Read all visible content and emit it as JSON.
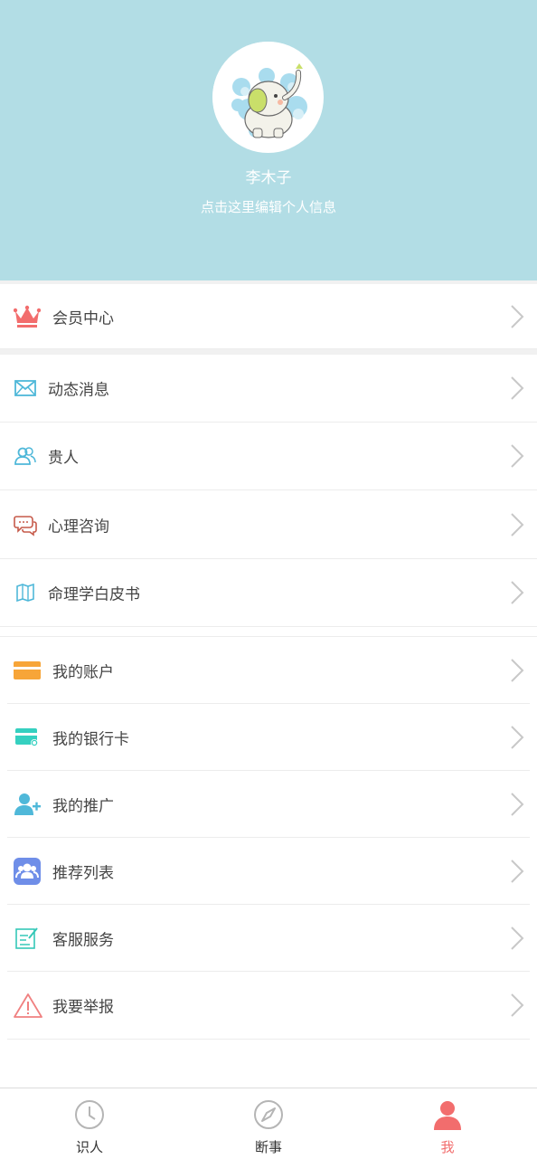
{
  "profile": {
    "name": "李木子",
    "edit_hint": "点击这里编辑个人信息"
  },
  "menu": [
    {
      "label": "会员中心",
      "icon": "crown-icon"
    },
    {
      "label": "动态消息",
      "icon": "envelope-icon"
    },
    {
      "label": "贵人",
      "icon": "people-icon"
    },
    {
      "label": "心理咨询",
      "icon": "chat-bubbles-icon"
    },
    {
      "label": "命理学白皮书",
      "icon": "map-book-icon"
    },
    {
      "label": "我的账户",
      "icon": "card-icon"
    },
    {
      "label": "我的银行卡",
      "icon": "bank-card-icon"
    },
    {
      "label": "我的推广",
      "icon": "add-user-icon"
    },
    {
      "label": "推荐列表",
      "icon": "group-icon"
    },
    {
      "label": "客服服务",
      "icon": "edit-note-icon"
    },
    {
      "label": "我要举报",
      "icon": "warning-icon"
    }
  ],
  "tabs": [
    {
      "label": "识人",
      "icon": "clock-icon",
      "active": false
    },
    {
      "label": "断事",
      "icon": "compass-icon",
      "active": false
    },
    {
      "label": "我",
      "icon": "person-icon",
      "active": true
    }
  ],
  "colors": {
    "header_bg": "#b2dde5",
    "crown": "#f26d6d",
    "accent_blue": "#4fb8d9",
    "card_orange": "#f7a538",
    "bank_teal": "#35d0c0",
    "group_blue": "#6f8ee8",
    "warning_red": "#f08080",
    "active_tab": "#f26d6d"
  }
}
